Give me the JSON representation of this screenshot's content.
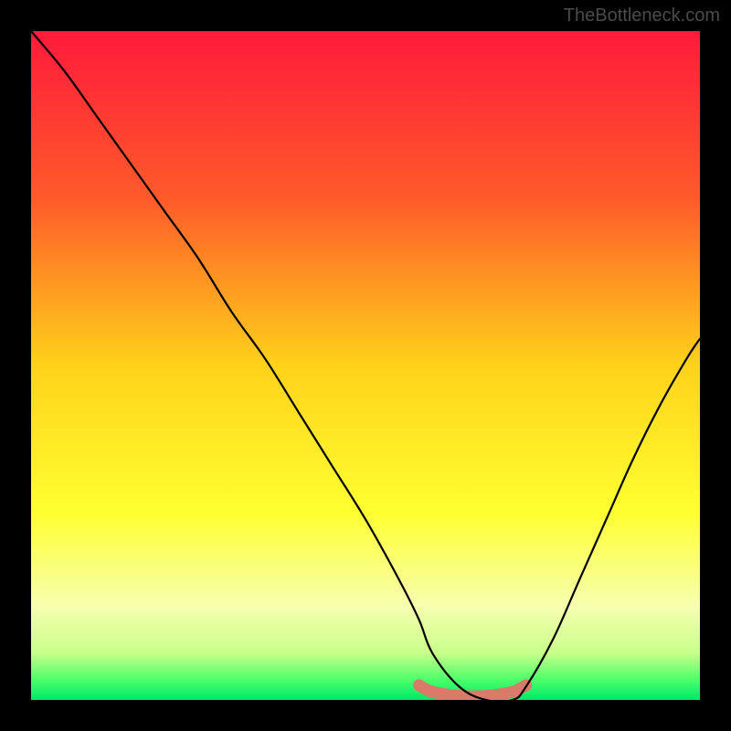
{
  "watermark": "TheBottleneck.com",
  "chart_data": {
    "type": "line",
    "title": "",
    "xlabel": "",
    "ylabel": "",
    "xlim": [
      0,
      100
    ],
    "ylim": [
      0,
      100
    ],
    "gradient_stops": [
      {
        "offset": 0,
        "color": "#ff1a3c"
      },
      {
        "offset": 25,
        "color": "#ff5a2a"
      },
      {
        "offset": 50,
        "color": "#ffd21a"
      },
      {
        "offset": 72,
        "color": "#ffff30"
      },
      {
        "offset": 86,
        "color": "#f7ffb0"
      },
      {
        "offset": 93,
        "color": "#c8ff8a"
      },
      {
        "offset": 97,
        "color": "#4cff6a"
      },
      {
        "offset": 100,
        "color": "#00e86a"
      }
    ],
    "series": [
      {
        "name": "bottleneck-curve",
        "x": [
          0,
          5,
          10,
          15,
          20,
          25,
          30,
          35,
          40,
          45,
          50,
          55,
          58,
          60,
          64,
          68,
          72,
          74,
          78,
          82,
          86,
          90,
          94,
          98,
          100
        ],
        "y": [
          100,
          94,
          87,
          80,
          73,
          66,
          58,
          51,
          43,
          35,
          27,
          18,
          12,
          7,
          2,
          0,
          0,
          2,
          9,
          18,
          27,
          36,
          44,
          51,
          54
        ]
      },
      {
        "name": "flat-zone-marker",
        "x": [
          58,
          60,
          64,
          68,
          72,
          74
        ],
        "y": [
          2.2,
          1.2,
          0.6,
          0.6,
          1.2,
          2.2
        ]
      }
    ]
  }
}
